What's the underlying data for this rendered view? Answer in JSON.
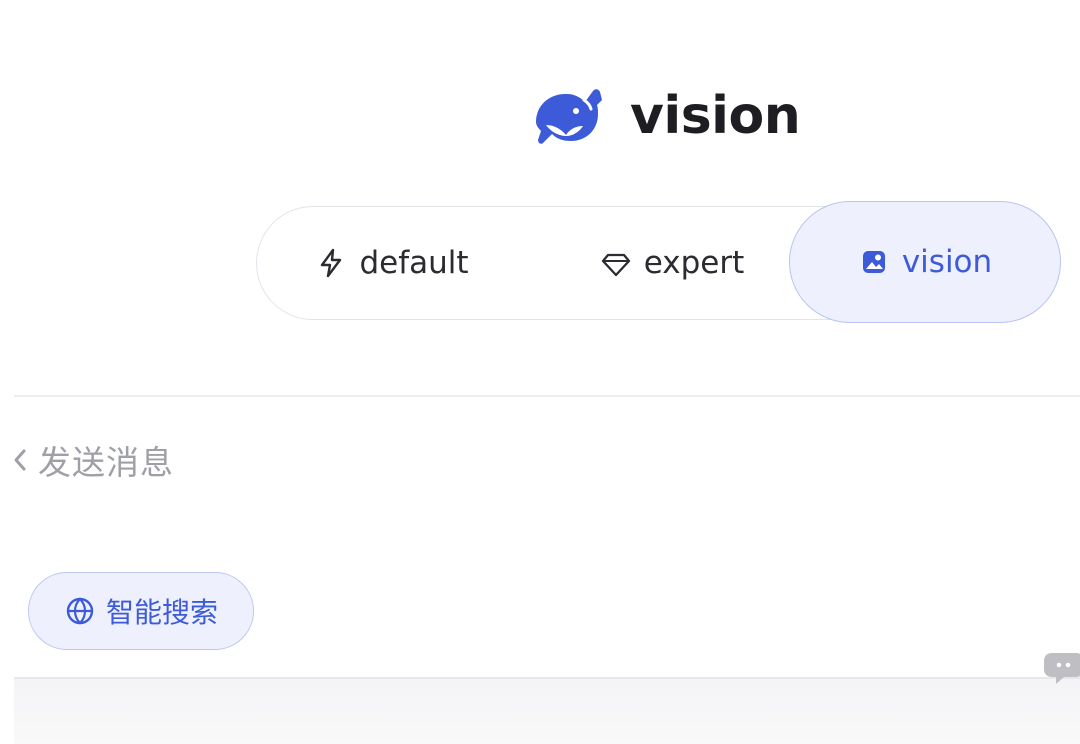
{
  "header": {
    "logo_icon": "whale-logo-icon",
    "title": "vision"
  },
  "modes": [
    {
      "label": "default",
      "icon": "bolt-icon",
      "selected": false
    },
    {
      "label": "expert",
      "icon": "diamond-icon",
      "selected": false
    },
    {
      "label": "vision",
      "icon": "image-icon",
      "selected": true
    }
  ],
  "composer": {
    "back_icon": "chevron-left-icon",
    "placeholder": "发送消息"
  },
  "search_chip": {
    "icon": "globe-icon",
    "label": "智能搜索"
  },
  "colors": {
    "accent": "#3d5bd9",
    "accent_bg": "#eef1fd",
    "text": "#1f1f23",
    "muted": "#9fa0a7"
  }
}
